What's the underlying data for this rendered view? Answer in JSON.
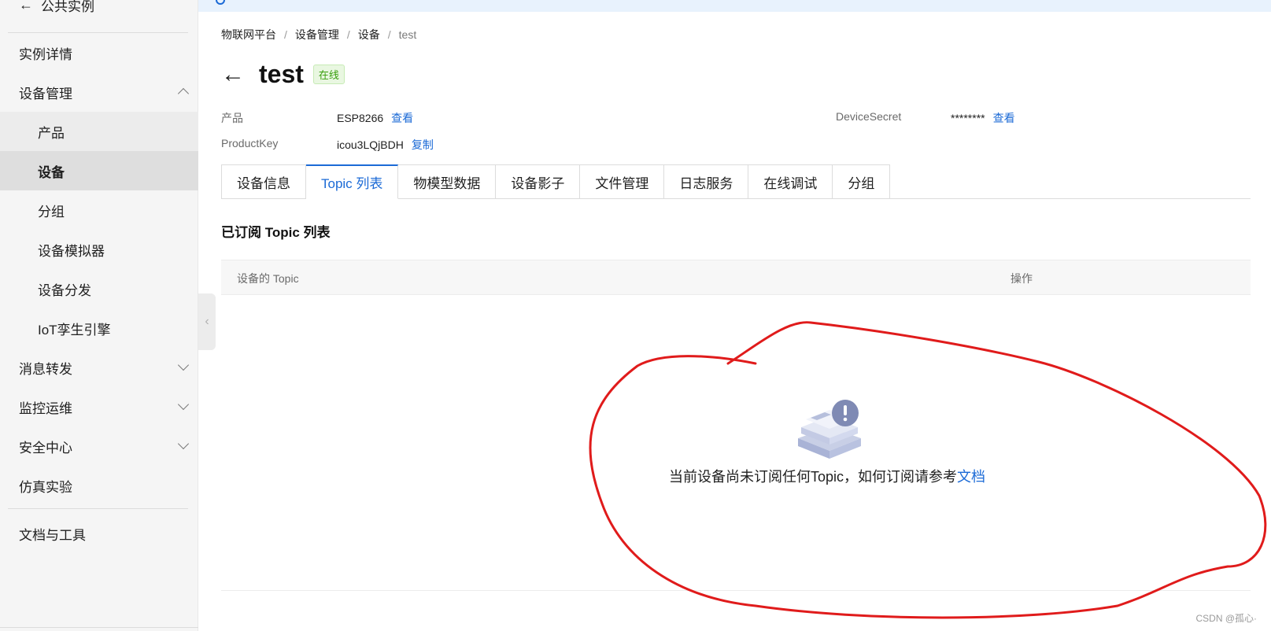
{
  "sidebar": {
    "back_label": "公共实例",
    "items": [
      {
        "label": "实例详情"
      },
      {
        "label": "设备管理"
      },
      {
        "label": "产品"
      },
      {
        "label": "设备"
      },
      {
        "label": "分组"
      },
      {
        "label": "设备模拟器"
      },
      {
        "label": "设备分发"
      },
      {
        "label": "IoT孪生引擎"
      },
      {
        "label": "消息转发"
      },
      {
        "label": "监控运维"
      },
      {
        "label": "安全中心"
      },
      {
        "label": "仿真实验"
      },
      {
        "label": "文档与工具"
      }
    ]
  },
  "breadcrumb": [
    "物联网平台",
    "设备管理",
    "设备",
    "test"
  ],
  "header": {
    "title": "test",
    "status": "在线"
  },
  "info": {
    "product_label": "产品",
    "product_value": "ESP8266",
    "product_link": "查看",
    "productkey_label": "ProductKey",
    "productkey_value": "icou3LQjBDH",
    "productkey_link": "复制",
    "secret_label": "DeviceSecret",
    "secret_value": "********",
    "secret_link": "查看"
  },
  "tabs": [
    {
      "label": "设备信息"
    },
    {
      "label": "Topic 列表"
    },
    {
      "label": "物模型数据"
    },
    {
      "label": "设备影子"
    },
    {
      "label": "文件管理"
    },
    {
      "label": "日志服务"
    },
    {
      "label": "在线调试"
    },
    {
      "label": "分组"
    }
  ],
  "section": {
    "title": "已订阅 Topic 列表"
  },
  "table": {
    "col_topic": "设备的 Topic",
    "col_action": "操作"
  },
  "empty": {
    "text": "当前设备尚未订阅任何Topic，如何订阅请参考",
    "link": "文档"
  },
  "watermark": "CSDN @孤心·",
  "colors": {
    "accent": "#1b6ad6",
    "online_green": "#389e0d",
    "annotation_red": "#e01b1b"
  }
}
